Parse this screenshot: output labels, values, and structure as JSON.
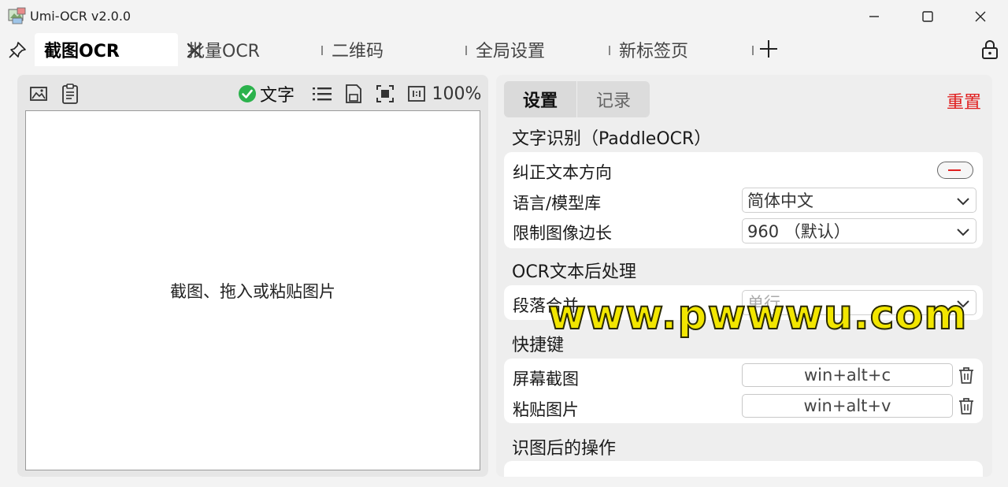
{
  "window": {
    "title": "Umi-OCR v2.0.0",
    "controls": {
      "minimize": "minimize-icon",
      "maximize": "maximize-icon",
      "close": "close-icon"
    }
  },
  "tabs": [
    {
      "label": "截图OCR",
      "active": true
    },
    {
      "label": "批量OCR",
      "active": false
    },
    {
      "label": "二维码",
      "active": false
    },
    {
      "label": "全局设置",
      "active": false
    },
    {
      "label": "新标签页",
      "active": false
    }
  ],
  "left_panel": {
    "toolbar": {
      "text_toggle_label": "文字",
      "zoom": "100%"
    },
    "canvas_hint": "截图、拖入或粘贴图片"
  },
  "right_panel": {
    "tabs": [
      "设置",
      "记录"
    ],
    "reset_label": "重置",
    "sections": [
      {
        "title": "文字识别（PaddleOCR）",
        "rows": [
          {
            "label": "纠正文本方向",
            "type": "toggle"
          },
          {
            "label": "语言/模型库",
            "type": "select",
            "value": "简体中文"
          },
          {
            "label": "限制图像边长",
            "type": "select",
            "value": "960 （默认）"
          }
        ]
      },
      {
        "title": "OCR文本后处理",
        "rows": [
          {
            "label": "段落合并",
            "type": "select",
            "value": "单行"
          }
        ]
      },
      {
        "title": "快捷键",
        "rows": [
          {
            "label": "屏幕截图",
            "type": "hotkey",
            "value": "win+alt+c"
          },
          {
            "label": "粘贴图片",
            "type": "hotkey",
            "value": "win+alt+v"
          }
        ]
      },
      {
        "title": "识图后的操作",
        "rows": []
      }
    ]
  },
  "watermark": "www.pwwwu.com",
  "colors": {
    "accent_red": "#e02020",
    "check_green": "#2bb24c"
  }
}
